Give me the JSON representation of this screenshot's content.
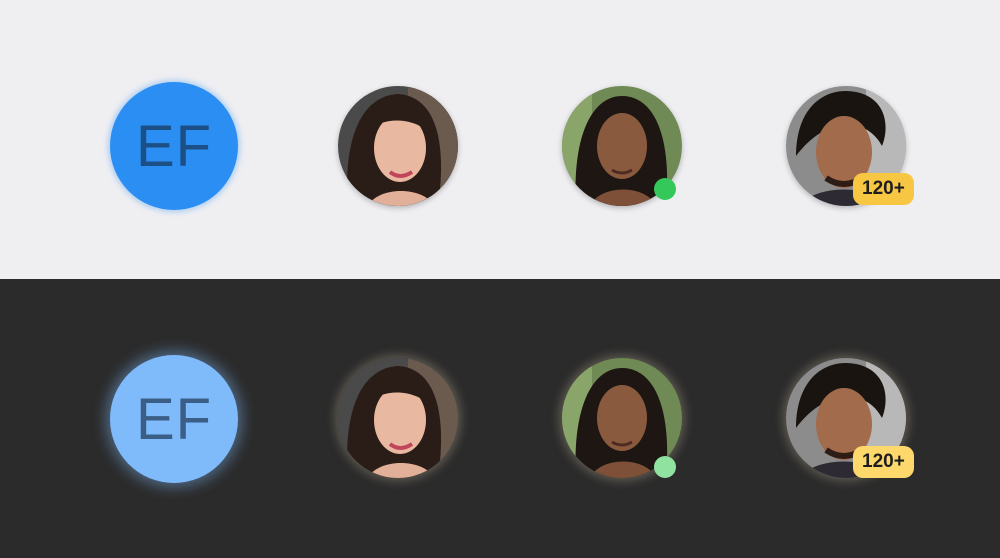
{
  "avatars": {
    "initials": "EF",
    "count_badge": "120+"
  },
  "themes": [
    {
      "name": "light",
      "background": "#efeff2",
      "accent": "#2b8ef2",
      "status": "#34c759",
      "badge": "#f7c744"
    },
    {
      "name": "dark",
      "background": "#2b2b2b",
      "accent": "#7fbafa",
      "status": "#8fe2a0",
      "badge": "#ffd86b"
    }
  ]
}
